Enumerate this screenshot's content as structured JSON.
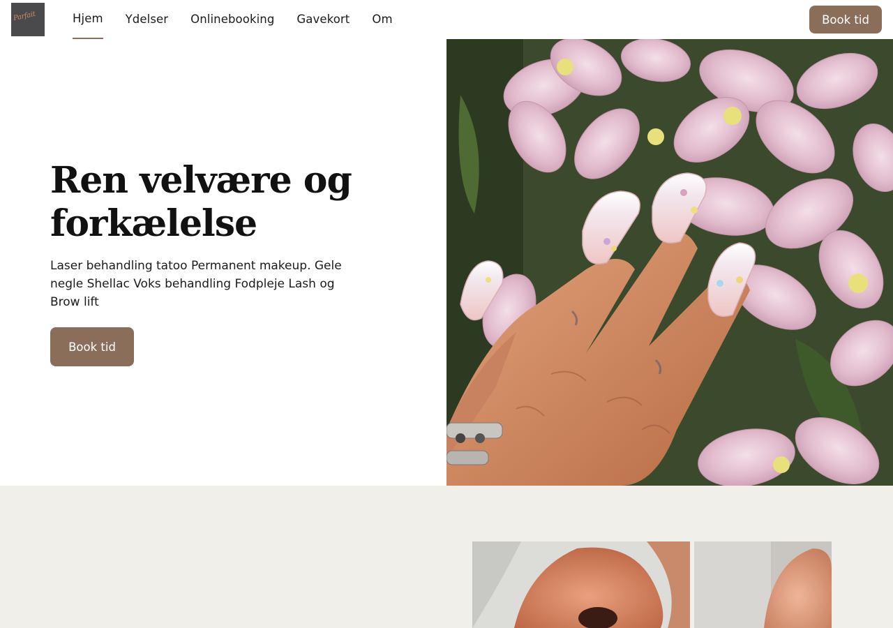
{
  "header": {
    "logo_alt": "Parfait",
    "nav": [
      {
        "label": "Hjem",
        "active": true
      },
      {
        "label": "Ydelser",
        "active": false
      },
      {
        "label": "Onlinebooking",
        "active": false
      },
      {
        "label": "Gavekort",
        "active": false
      },
      {
        "label": "Om",
        "active": false
      }
    ],
    "book_label": "Book tid"
  },
  "hero": {
    "title": "Ren velvære og forkælelse",
    "description": "Laser behandling tatoo Permanent makeup. Gele negle Shellac Voks behandling Fodpleje Lash og Brow lift",
    "book_label": "Book tid"
  },
  "colors": {
    "accent": "#8a6e5a",
    "section_bg": "#f1efea",
    "text": "#1b1b1b"
  }
}
